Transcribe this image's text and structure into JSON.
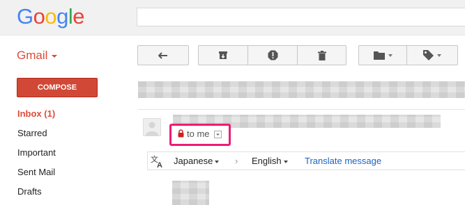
{
  "header": {
    "logo_letters": [
      {
        "ch": "G",
        "color": "#4285f4"
      },
      {
        "ch": "o",
        "color": "#ea4335"
      },
      {
        "ch": "o",
        "color": "#fbbc05"
      },
      {
        "ch": "g",
        "color": "#4285f4"
      },
      {
        "ch": "l",
        "color": "#34a853"
      },
      {
        "ch": "e",
        "color": "#ea4335"
      }
    ],
    "search_value": ""
  },
  "app": {
    "name": "Gmail",
    "accent": "#dd4b39"
  },
  "toolbar": {
    "back_icon": "back-arrow-icon",
    "archive_icon": "archive-icon",
    "spam_icon": "report-spam-icon",
    "delete_icon": "trash-icon",
    "move_icon": "folder-icon",
    "labels_icon": "label-tag-icon"
  },
  "sidebar": {
    "compose_label": "COMPOSE",
    "compose_color": "#d14836",
    "items": [
      {
        "label": "Inbox (1)"
      },
      {
        "label": "Starred"
      },
      {
        "label": "Important"
      },
      {
        "label": "Sent Mail"
      },
      {
        "label": "Drafts"
      }
    ]
  },
  "message": {
    "recipient_label": "to me",
    "lock_icon": "lock-icon",
    "highlight_color": "#ee1b74"
  },
  "translate": {
    "icon": "translate-icon",
    "from_lang": "Japanese",
    "separator": "›",
    "to_lang": "English",
    "action_label": "Translate message"
  }
}
